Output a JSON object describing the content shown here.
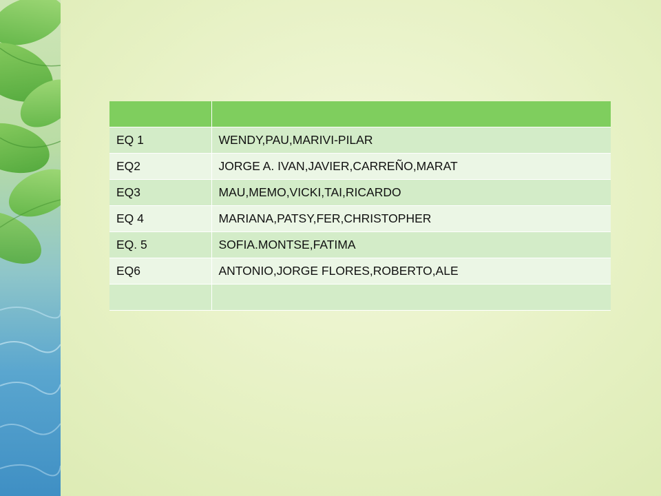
{
  "slide": {
    "background_color": "#e6f1c3",
    "decoration": {
      "description_icon": "leaves-water-strip-icon",
      "colors": {
        "leaf": "#6fbf4a",
        "water": "#3f8fc4"
      }
    }
  },
  "table": {
    "header": [
      "",
      ""
    ],
    "rows": [
      {
        "team": "EQ 1",
        "members": "WENDY,PAU,MARIVI-PILAR"
      },
      {
        "team": "EQ2",
        "members": "JORGE A. IVAN,JAVIER,CARREÑO,MARAT"
      },
      {
        "team": "EQ3",
        "members": "MAU,MEMO,VICKI,TAI,RICARDO"
      },
      {
        "team": "EQ 4",
        "members": "MARIANA,PATSY,FER,CHRISTOPHER"
      },
      {
        "team": "EQ. 5",
        "members": "SOFIA.MONTSE,FATIMA"
      },
      {
        "team": "EQ6",
        "members": "ANTONIO,JORGE FLORES,ROBERTO,ALE"
      },
      {
        "team": "",
        "members": ""
      }
    ],
    "colors": {
      "header": "#7fce5e",
      "row_dark": "#d3ecc8",
      "row_light": "#ebf6e5"
    }
  }
}
